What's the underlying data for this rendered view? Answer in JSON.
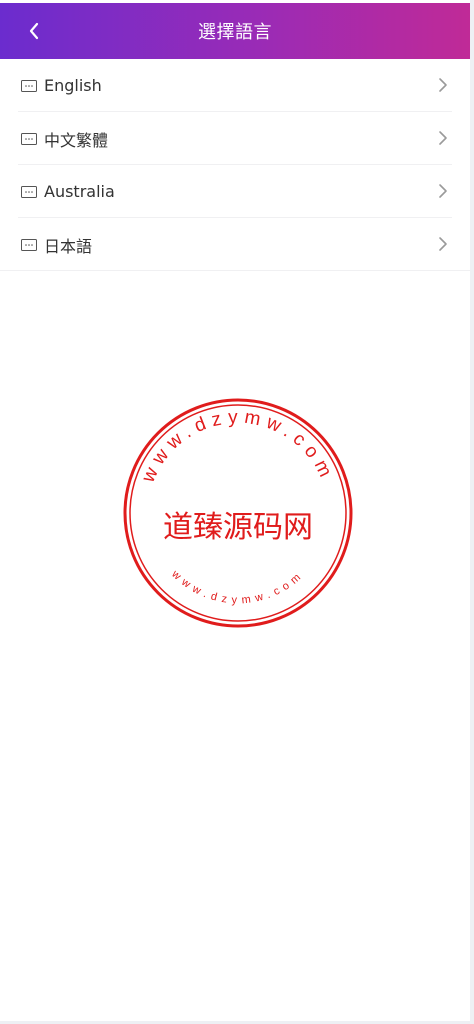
{
  "header": {
    "title": "選擇語言",
    "back_icon": "chevron-left-icon",
    "gradient": [
      "#6b2cce",
      "#c02a97"
    ]
  },
  "languages": [
    {
      "label": "English",
      "icon": "flag-placeholder-icon"
    },
    {
      "label": "中文繁體",
      "icon": "flag-placeholder-icon"
    },
    {
      "label": "Australia",
      "icon": "flag-placeholder-icon"
    },
    {
      "label": "日本語",
      "icon": "flag-placeholder-icon"
    }
  ],
  "watermark": {
    "center_text": "道臻源码网",
    "top_arc": "www.dzymw.com",
    "bottom_arc": "www.dzymw.com",
    "color": "#e01c1c"
  }
}
